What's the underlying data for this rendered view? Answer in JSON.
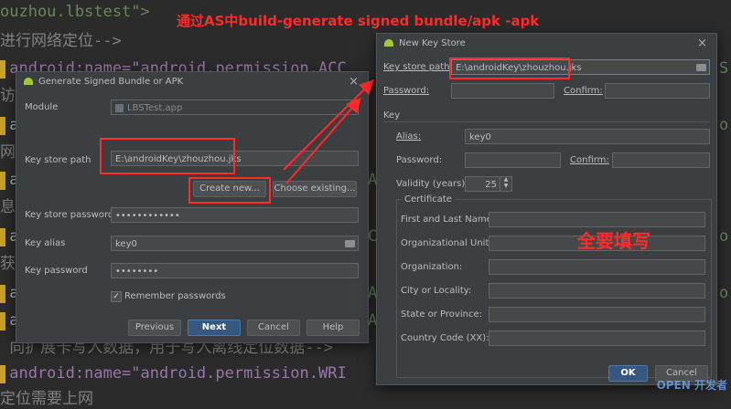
{
  "editor": {
    "lines": [
      {
        "text": "ouzhou.lbstest\">",
        "color": "#a9b7c6"
      },
      {
        "text": "进行网络定位-->",
        "color": "#808080"
      },
      {
        "text": " android:name=\"android.permission.ACC",
        "color": "#a9b7c6"
      },
      {
        "text": "访问",
        "color": "#808080"
      },
      {
        "text": " a",
        "color": "#a9b7c6"
      },
      {
        "text": "网",
        "color": "#808080"
      },
      {
        "text": " a",
        "color": "#a9b7c6"
      },
      {
        "text": "息,",
        "color": "#808080"
      },
      {
        "text": " a",
        "color": "#a9b7c6"
      },
      {
        "text": "获耳",
        "color": "#808080"
      },
      {
        "text": " a",
        "color": "#a9b7c6"
      },
      {
        "text": " a",
        "color": "#a9b7c6"
      },
      {
        "text": " 向扩展卡写入数据，用于写入离线定位数据-->",
        "color": "#808080"
      },
      {
        "text": " android:name=\"android.permission.WRI",
        "color": "#a9b7c6"
      },
      {
        "text": "定位需要上网",
        "color": "#808080"
      }
    ],
    "right_chars": [
      "S",
      "o",
      "o",
      "o"
    ],
    "right_chars_mid": [
      "A",
      "C",
      "A",
      "A"
    ]
  },
  "annotation_top": "通过AS中build-generate signed bundle/apk -apk",
  "annotation_cn": "全要填写",
  "dialog1": {
    "title": "Generate Signed Bundle or APK",
    "module_label": "Module",
    "module_value": "LBSTest.app",
    "key_store_path_label": "Key store path",
    "key_store_path_value": "E:\\androidKey\\zhouzhou.jks",
    "create_new_label": "Create new...",
    "choose_existing_label": "Choose existing...",
    "key_store_password_label": "Key store password",
    "key_store_password_value": "••••••••••••",
    "key_alias_label": "Key alias",
    "key_alias_value": "key0",
    "key_password_label": "Key password",
    "key_password_value": "••••••••",
    "remember_label": "Remember passwords",
    "previous_label": "Previous",
    "next_label": "Next",
    "cancel_label": "Cancel",
    "help_label": "Help"
  },
  "dialog2": {
    "title": "New Key Store",
    "key_store_path_label": "Key store path:",
    "key_store_path_value": "E:\\androidKey\\zhouzhou.jks",
    "password_label": "Password:",
    "confirm_label": "Confirm:",
    "key_section": "Key",
    "alias_label": "Alias:",
    "alias_value": "key0",
    "key_password_label": "Password:",
    "key_confirm_label": "Confirm:",
    "validity_label": "Validity (years):",
    "validity_value": "25",
    "certificate_section": "Certificate",
    "first_last_label": "First and Last Name:",
    "org_unit_label": "Organizational Unit:",
    "org_label": "Organization:",
    "city_label": "City or Locality:",
    "state_label": "State or Province:",
    "country_label": "Country Code (XX):",
    "ok_label": "OK",
    "cancel_label": "Cancel"
  },
  "watermark": "OPEN 开发者"
}
